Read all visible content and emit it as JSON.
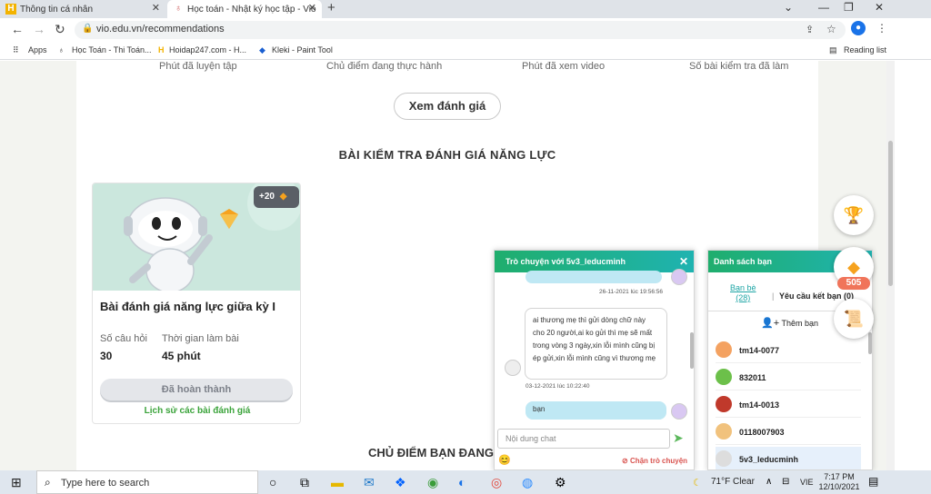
{
  "browser": {
    "tabs": [
      {
        "label": "Thông tin cá nhân"
      },
      {
        "label": "Học toán - Nhật ký học tập - Vio"
      }
    ],
    "url": "vio.edu.vn/recommendations",
    "bookmarks": [
      "Apps",
      "Học Toán - Thi Toán...",
      "Hoidap247.com - H...",
      "Kleki - Paint Tool"
    ],
    "reading_list": "Reading list"
  },
  "stats_labels": [
    "Phút đã luyện tập",
    "Chủ điểm đang thực hành",
    "Phút đã xem video",
    "Số bài kiểm tra đã làm"
  ],
  "review_button": "Xem đánh giá",
  "section_title": "BÀI KIỂM TRA ĐÁNH GIÁ NĂNG LỰC",
  "section2_title": "CHỦ ĐIỂM BẠN ĐANG",
  "card": {
    "gem_count": "+20",
    "title": "Bài đánh giá năng lực giữa kỳ I",
    "questions_label": "Số câu hỏi",
    "questions_value": "30",
    "time_label": "Thời gian làm bài",
    "time_value": "45 phút",
    "done_button": "Đã hoàn thành",
    "history_link": "Lịch sử các bài đánh giá"
  },
  "chat": {
    "header": "Trò chuyện với 5v3_leducminh",
    "messages": [
      {
        "time": "26-11-2021 lúc 19:56:56"
      },
      {
        "text": "ai thương mẹ thì gửi dòng chữ này cho 20 người,ai ko gửi thì mẹ sẽ mất trong vòng 3 ngày,xin lỗi mình cũng bị ép gửi,xin lỗi mình cũng vì thương mẹ",
        "time": "03-12-2021 lúc 10:22:40"
      },
      {
        "text": "bạn"
      }
    ],
    "input_placeholder": "Nội dung chat",
    "block_label": "Chặn trò chuyện"
  },
  "friends_panel": {
    "header": "Danh sách bạn",
    "tab_friends": "Bạn bè",
    "tab_friends_count": "(28)",
    "tab_requests": "Yêu cầu kết bạn (0)",
    "add_friend": "Thêm bạn",
    "friends": [
      {
        "name": "tm14-0077"
      },
      {
        "name": "832011"
      },
      {
        "name": "tm14-0013"
      },
      {
        "name": "0118007903"
      },
      {
        "name": "5v3_leducminh"
      }
    ]
  },
  "badge_505": "505",
  "taskbar": {
    "search_placeholder": "Type here to search",
    "weather": "71°F  Clear",
    "lang": "VIE",
    "time": "7:17 PM",
    "date": "12/10/2021"
  }
}
